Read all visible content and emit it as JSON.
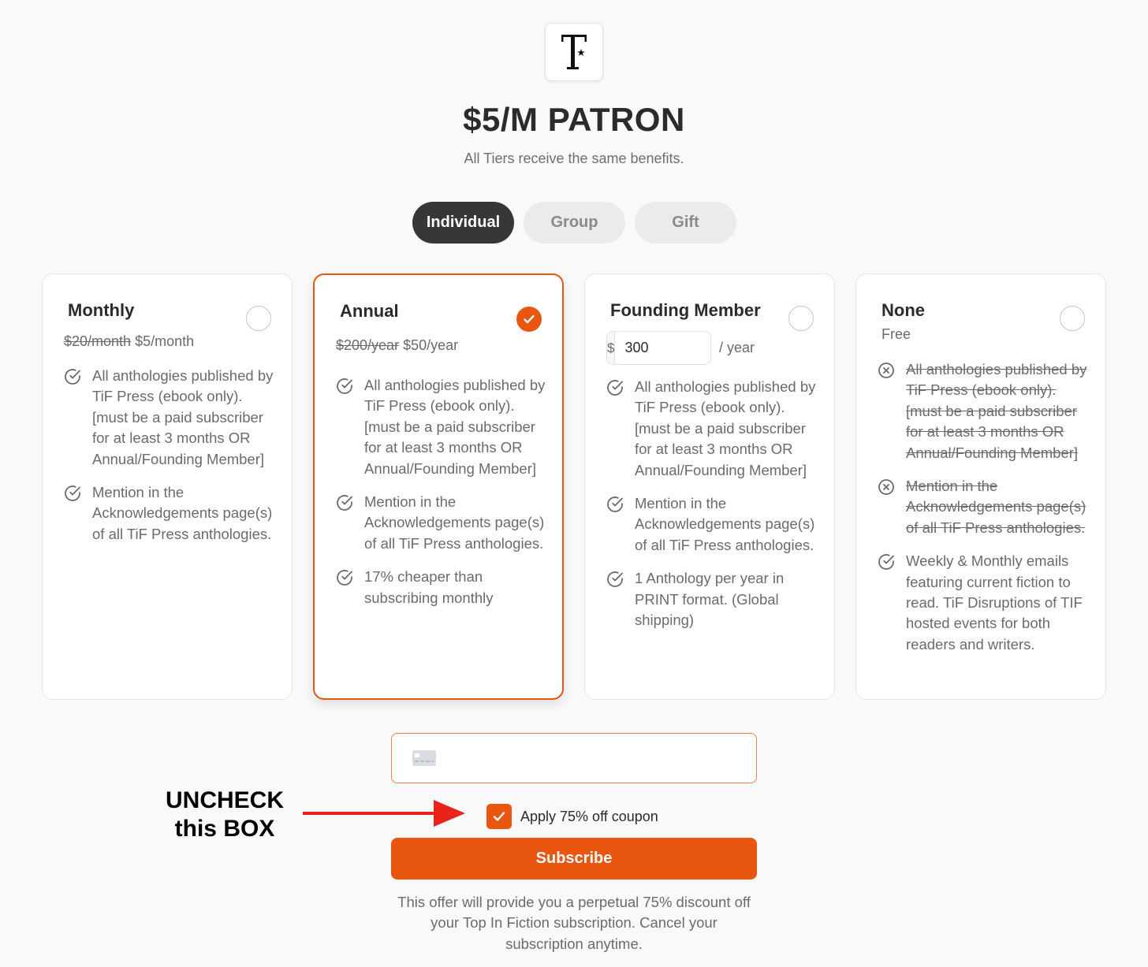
{
  "header": {
    "title": "$5/M PATRON",
    "subtitle": "All Tiers receive the same benefits."
  },
  "tabs": [
    {
      "label": "Individual",
      "active": true
    },
    {
      "label": "Group",
      "active": false
    },
    {
      "label": "Gift",
      "active": false
    }
  ],
  "plans": [
    {
      "name": "Monthly",
      "old_price": "$20/month",
      "price": "$5/month",
      "selected": false,
      "features": [
        {
          "text": "All anthologies published by TiF Press (ebook only). [must be a paid subscriber for at least 3 months OR Annual/Founding Member]",
          "included": true
        },
        {
          "text": "Mention in the Acknowledgements page(s) of all TiF Press anthologies.",
          "included": true
        }
      ]
    },
    {
      "name": "Annual",
      "old_price": "$200/year",
      "price": "$50/year",
      "selected": true,
      "features": [
        {
          "text": "All anthologies published by TiF Press (ebook only). [must be a paid subscriber for at least 3 months OR Annual/Founding Member]",
          "included": true
        },
        {
          "text": "Mention in the Acknowledgements page(s) of all TiF Press anthologies.",
          "included": true
        },
        {
          "text": "17% cheaper than subscribing monthly",
          "included": true
        }
      ]
    },
    {
      "name": "Founding Member",
      "currency_symbol": "$",
      "amount_value": "300",
      "amount_suffix": "/ year",
      "selected": false,
      "features": [
        {
          "text": "All anthologies published by TiF Press (ebook only). [must be a paid subscriber for at least 3 months OR Annual/Founding Member]",
          "included": true
        },
        {
          "text": "Mention in the Acknowledgements page(s) of all TiF Press anthologies.",
          "included": true
        },
        {
          "text": "1 Anthology per year in PRINT format. (Global shipping)",
          "included": true
        }
      ]
    },
    {
      "name": "None",
      "price": "Free",
      "selected": false,
      "features": [
        {
          "text": "All anthologies published by TiF Press (ebook only). [must be a paid subscriber for at least 3 months OR Annual/Founding Member]",
          "included": false
        },
        {
          "text": "Mention in the Acknowledgements page(s) of all TiF Press anthologies.",
          "included": false
        },
        {
          "text": "Weekly & Monthly emails featuring current fiction to read. TiF Disruptions of TIF hosted events for both readers and writers.",
          "included": true
        }
      ]
    }
  ],
  "payment": {
    "card_icon": "credit-card-icon",
    "card_value": ""
  },
  "annotation": {
    "line1": "UNCHECK",
    "line2": "this BOX"
  },
  "coupon": {
    "label": "Apply 75% off coupon",
    "checked": true
  },
  "subscribe_label": "Subscribe",
  "footnote": "This offer will provide you a perpetual 75% discount off your Top In Fiction subscription. Cancel your subscription anytime.",
  "colors": {
    "accent": "#e8560f",
    "dark": "#363737",
    "muted": "#6b6b6b",
    "arrow": "#e8231a"
  }
}
